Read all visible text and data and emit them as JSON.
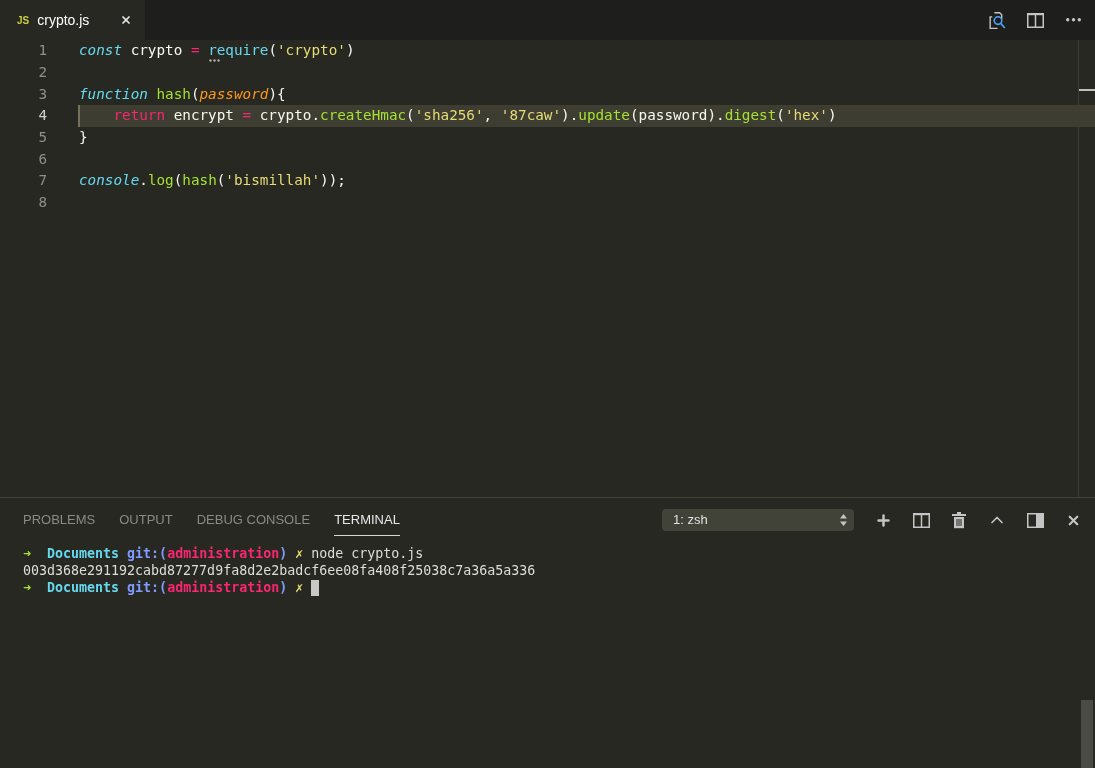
{
  "tabs": [
    {
      "icon_label": "JS",
      "title": "crypto.js",
      "selected": true
    }
  ],
  "editor": {
    "lines": [
      {
        "number": "1",
        "current": false,
        "hint": true,
        "tokens": [
          {
            "text": "const",
            "kind": "storage"
          },
          {
            "text": " crypto ",
            "kind": "plain"
          },
          {
            "text": "= ",
            "kind": "operator"
          },
          {
            "text": "require",
            "kind": "support"
          },
          {
            "text": "(",
            "kind": "plain"
          },
          {
            "text": "'crypto'",
            "kind": "string"
          },
          {
            "text": ")",
            "kind": "plain"
          }
        ]
      },
      {
        "number": "2",
        "current": false,
        "hint": false
      },
      {
        "number": "3",
        "current": false,
        "hint": false,
        "tokens": [
          {
            "text": "function ",
            "kind": "storage"
          },
          {
            "text": "hash",
            "kind": "function"
          },
          {
            "text": "(",
            "kind": "plain"
          },
          {
            "text": "password",
            "kind": "parameter"
          },
          {
            "text": "){",
            "kind": "plain"
          }
        ]
      },
      {
        "number": "4",
        "current": true,
        "hint": false,
        "tokens": [
          {
            "text": "    return",
            "kind": "keyword"
          },
          {
            "text": " encrypt ",
            "kind": "plain"
          },
          {
            "text": "=",
            "kind": "operator"
          },
          {
            "text": " crypto.",
            "kind": "plain"
          },
          {
            "text": "createHmac",
            "kind": "function"
          },
          {
            "text": "(",
            "kind": "plain"
          },
          {
            "text": "'sha256'",
            "kind": "string"
          },
          {
            "text": ", ",
            "kind": "plain"
          },
          {
            "text": "'87caw'",
            "kind": "string"
          },
          {
            "text": ").",
            "kind": "plain"
          },
          {
            "text": "update",
            "kind": "function"
          },
          {
            "text": "(password).",
            "kind": "plain"
          },
          {
            "text": "digest",
            "kind": "function"
          },
          {
            "text": "(",
            "kind": "plain"
          },
          {
            "text": "'hex'",
            "kind": "string"
          },
          {
            "text": ")",
            "kind": "plain"
          }
        ]
      },
      {
        "number": "5",
        "current": false,
        "hint": false,
        "tokens": [
          {
            "text": "}",
            "kind": "plain"
          }
        ]
      },
      {
        "number": "6",
        "current": false,
        "hint": false
      },
      {
        "number": "7",
        "current": false,
        "hint": false,
        "tokens": [
          {
            "text": "console",
            "kind": "storage"
          },
          {
            "text": ".",
            "kind": "plain"
          },
          {
            "text": "log",
            "kind": "function"
          },
          {
            "text": "(",
            "kind": "plain"
          },
          {
            "text": "hash",
            "kind": "function"
          },
          {
            "text": "(",
            "kind": "plain"
          },
          {
            "text": "'bismillah'",
            "kind": "string"
          },
          {
            "text": "));",
            "kind": "plain"
          }
        ]
      },
      {
        "number": "8",
        "current": false,
        "hint": false
      }
    ]
  },
  "panel": {
    "tabs": [
      {
        "label": "PROBLEMS",
        "selected": false
      },
      {
        "label": "OUTPUT",
        "selected": false
      },
      {
        "label": "DEBUG CONSOLE",
        "selected": false
      },
      {
        "label": "TERMINAL",
        "selected": true
      }
    ],
    "terminal_select": {
      "value": "1: zsh"
    },
    "terminal": {
      "lines": [
        {
          "cursor": false,
          "segments": [
            {
              "text": "➜  ",
              "kind": "arrow"
            },
            {
              "text": "Documents ",
              "kind": "dir"
            },
            {
              "text": "git:(",
              "kind": "git"
            },
            {
              "text": "administration",
              "kind": "branch"
            },
            {
              "text": ") ",
              "kind": "git"
            },
            {
              "text": "✗",
              "kind": "dirty"
            },
            {
              "text": " node crypto.js",
              "kind": "text"
            }
          ]
        },
        {
          "cursor": false,
          "segments": [
            {
              "text": "003d368e291192cabd87277d9fa8d2e2badcf6ee08fa408f25038c7a36a5a336",
              "kind": "text"
            }
          ]
        },
        {
          "cursor": true,
          "segments": [
            {
              "text": "➜  ",
              "kind": "arrow"
            },
            {
              "text": "Documents ",
              "kind": "dir"
            },
            {
              "text": "git:(",
              "kind": "git"
            },
            {
              "text": "administration",
              "kind": "branch"
            },
            {
              "text": ") ",
              "kind": "git"
            },
            {
              "text": "✗",
              "kind": "dirty"
            }
          ]
        }
      ]
    }
  }
}
